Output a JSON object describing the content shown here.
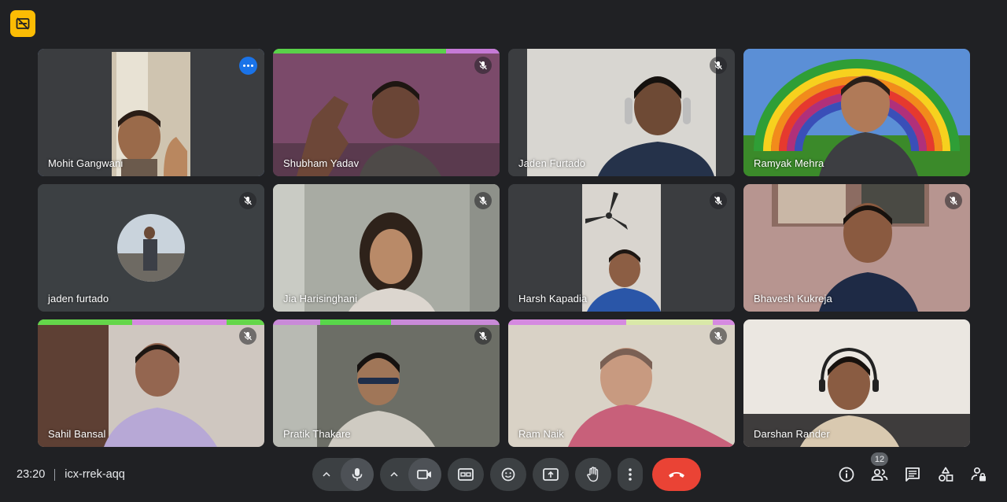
{
  "meeting": {
    "time": "23:20",
    "code": "icx-rrek-aqq"
  },
  "participants": [
    {
      "name": "Mohit Gangwani",
      "muted": false,
      "pinned": true
    },
    {
      "name": "Shubham Yadav",
      "muted": true
    },
    {
      "name": "Jaden Furtado",
      "muted": true
    },
    {
      "name": "Ramyak Mehra",
      "muted": false
    },
    {
      "name": "jaden furtado",
      "muted": true
    },
    {
      "name": "Jia Harisinghani",
      "muted": true
    },
    {
      "name": "Harsh Kapadia",
      "muted": true
    },
    {
      "name": "Bhavesh Kukreja",
      "muted": true
    },
    {
      "name": "Sahil Bansal",
      "muted": true
    },
    {
      "name": "Pratik Thakare",
      "muted": true
    },
    {
      "name": "Ram Naik",
      "muted": true
    },
    {
      "name": "Darshan Rander",
      "muted": false
    }
  ],
  "people_count": "12",
  "colors": {
    "background": "#202124",
    "tile": "#3c4043",
    "pinned_outline": "#8ab4f8",
    "hangup": "#ea4335",
    "badge": "#fbbc04"
  },
  "icons": {
    "top_badge": "caption-off-icon",
    "mute": "mic-off-icon",
    "more": "more-horiz-icon",
    "controls": [
      "chevron-up-icon",
      "mic-icon",
      "chevron-up-icon",
      "videocam-icon",
      "closed-caption-icon",
      "emoji-icon",
      "present-screen-icon",
      "raise-hand-icon",
      "more-vert-icon",
      "call-end-icon"
    ],
    "right": [
      "info-icon",
      "people-icon",
      "chat-icon",
      "activities-icon",
      "host-controls-icon"
    ]
  }
}
